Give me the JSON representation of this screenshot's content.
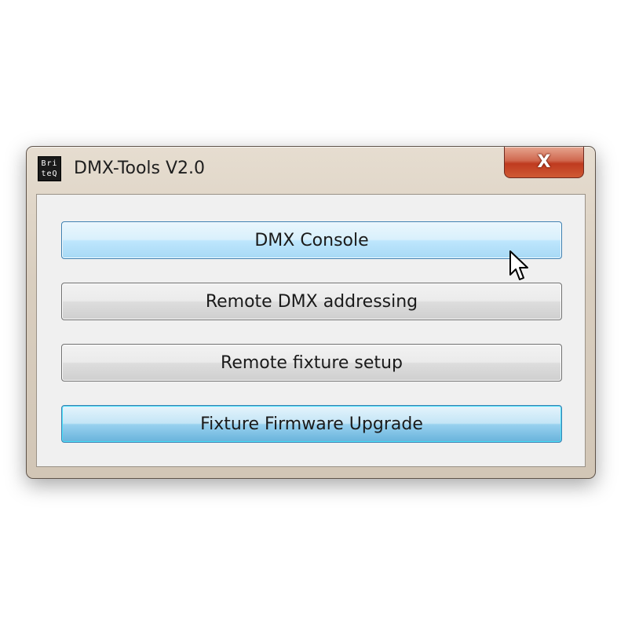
{
  "window": {
    "title": "DMX-Tools V2.0",
    "logo_line1": "Bri",
    "logo_line2": "teQ",
    "close_glyph": "X"
  },
  "buttons": [
    {
      "label": "DMX Console",
      "state": "hover"
    },
    {
      "label": "Remote DMX addressing",
      "state": "normal"
    },
    {
      "label": "Remote fixture setup",
      "state": "normal"
    },
    {
      "label": "Fixture Firmware Upgrade",
      "state": "focused"
    }
  ],
  "icons": {
    "logo": "britq-logo-icon",
    "close": "close-icon",
    "cursor": "mouse-pointer-icon"
  },
  "colors": {
    "close_button": "#c94a2c",
    "hover_button": "#bee6fd",
    "focus_border": "#3c7fb1"
  }
}
